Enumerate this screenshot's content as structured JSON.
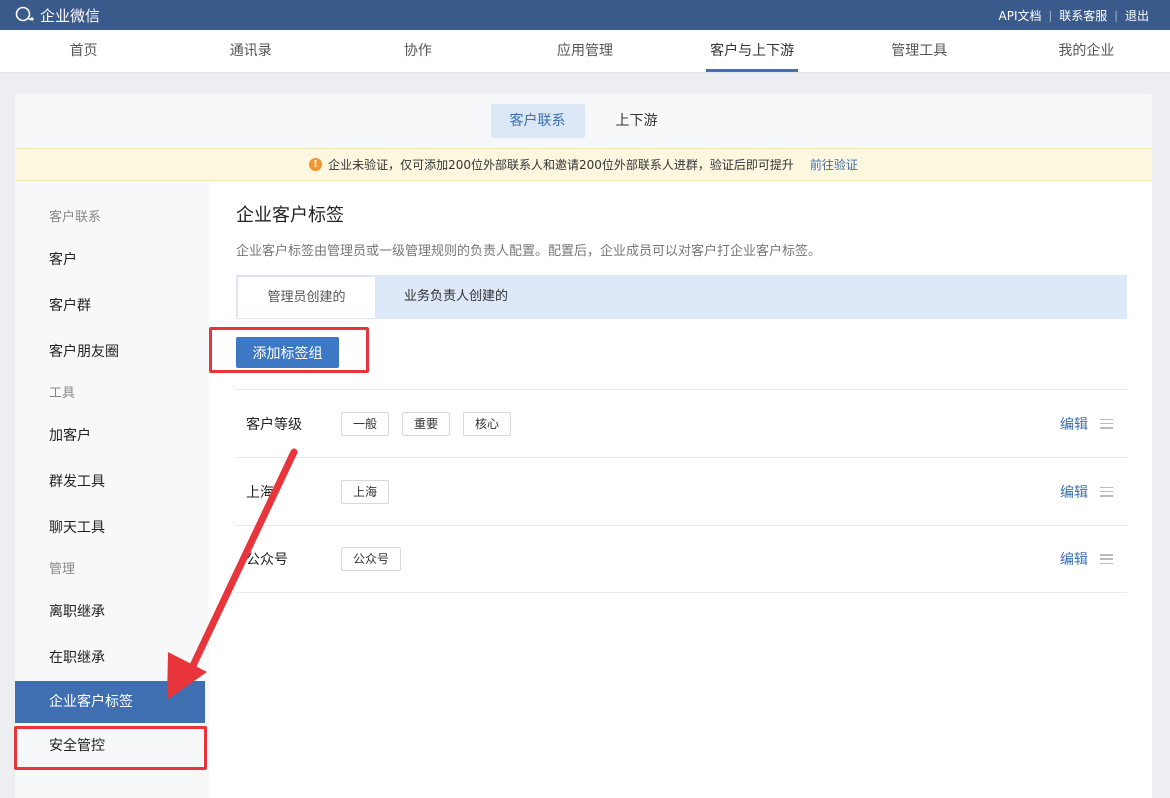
{
  "topbar": {
    "brand": "企业微信",
    "links": [
      "API文档",
      "联系客服",
      "退出"
    ]
  },
  "nav": {
    "items": [
      "首页",
      "通讯录",
      "协作",
      "应用管理",
      "客户与上下游",
      "管理工具",
      "我的企业"
    ],
    "active_index": 4
  },
  "subtabs": {
    "items": [
      "客户联系",
      "上下游"
    ],
    "active_index": 0
  },
  "notice": {
    "icon": "warning-icon",
    "text": "企业未验证，仅可添加200位外部联系人和邀请200位外部联系人进群，验证后即可提升",
    "link": "前往验证"
  },
  "sidebar": {
    "groups": [
      {
        "title": "客户联系",
        "items": [
          "客户",
          "客户群",
          "客户朋友圈"
        ]
      },
      {
        "title": "工具",
        "items": [
          "加客户",
          "群发工具",
          "聊天工具"
        ]
      },
      {
        "title": "管理",
        "items": [
          "离职继承",
          "在职继承",
          "企业客户标签",
          "安全管控"
        ]
      }
    ],
    "active_item": "企业客户标签"
  },
  "main": {
    "title": "企业客户标签",
    "description": "企业客户标签由管理员或一级管理规则的负责人配置。配置后，企业成员可以对客户打企业客户标签。",
    "tabs": [
      "管理员创建的",
      "业务负责人创建的"
    ],
    "active_tab": 0,
    "add_button": "添加标签组",
    "edit_label": "编辑",
    "tag_groups": [
      {
        "name": "客户等级",
        "tags": [
          "一般",
          "重要",
          "核心"
        ]
      },
      {
        "name": "上海",
        "tags": [
          "上海"
        ]
      },
      {
        "name": "公众号",
        "tags": [
          "公众号"
        ]
      }
    ]
  },
  "colors": {
    "topbar": "#3a5a8c",
    "accent": "#3d78c4",
    "highlight": "#e8353b",
    "notice_bg": "#fdf7e0"
  }
}
